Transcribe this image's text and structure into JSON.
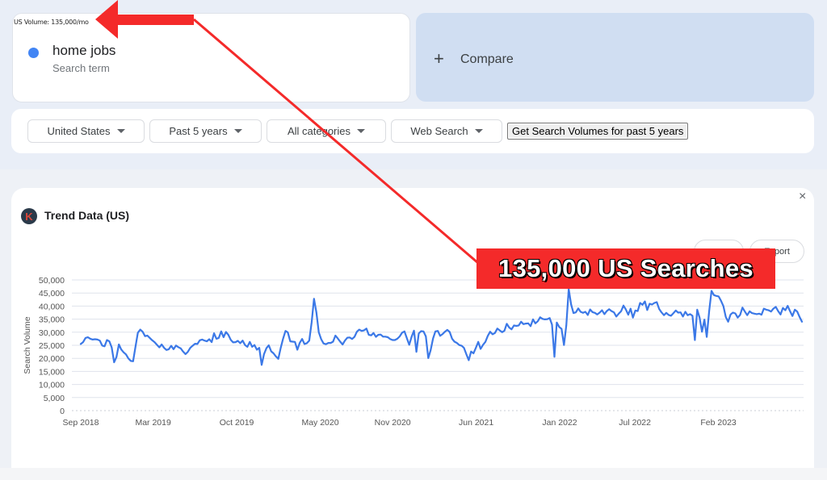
{
  "term_card": {
    "us_volume": "US Volume: 135,000/mo",
    "term": "home jobs",
    "subtitle": "Search term",
    "dot_color": "#4285f4"
  },
  "compare": {
    "icon": "plus-icon",
    "label": "Compare"
  },
  "filters": {
    "country": "United States",
    "period": "Past 5 years",
    "category": "All categories",
    "search_type": "Web Search",
    "get_button": "Get Search Volumes for past 5 years"
  },
  "chart_card": {
    "logo_letter": "K",
    "title": "Trend Data (US)",
    "close_icon": "×",
    "pill_left": "",
    "pill_right": "Export"
  },
  "annotation": {
    "banner": "135,000 US Searches",
    "color": "#f42a2a"
  },
  "chart_data": {
    "type": "line",
    "title": "Trend Data (US)",
    "xlabel": "",
    "ylabel": "Search Volume",
    "ylim": [
      0,
      50000
    ],
    "yticks": [
      0,
      5000,
      10000,
      15000,
      20000,
      25000,
      30000,
      35000,
      40000,
      45000,
      50000
    ],
    "ytick_labels": [
      "0",
      "5,000",
      "10,000",
      "15,000",
      "20,000",
      "25,000",
      "30,000",
      "35,000",
      "40,000",
      "45,000",
      "50,000"
    ],
    "xtick_labels": [
      "Sep 2018",
      "Mar 2019",
      "Oct 2019",
      "May 2020",
      "Nov 2020",
      "Jun 2021",
      "Jan 2022",
      "Jul 2022",
      "Feb 2023"
    ],
    "xtick_positions": [
      0,
      26,
      56,
      86,
      112,
      142,
      172,
      199,
      229
    ],
    "x_count": 260,
    "grid": true,
    "line_color": "#3b78e7",
    "series": [
      {
        "name": "home jobs",
        "values": [
          25500,
          26200,
          27800,
          28100,
          27500,
          27200,
          27300,
          27200,
          26800,
          24900,
          24600,
          27000,
          26500,
          24200,
          18500,
          20500,
          25300,
          23400,
          22300,
          21500,
          20000,
          19000,
          18900,
          24500,
          29800,
          31000,
          30200,
          28500,
          28700,
          27800,
          26900,
          26200,
          25200,
          24200,
          25300,
          24000,
          23200,
          23500,
          24800,
          23500,
          24900,
          24300,
          23800,
          22600,
          21600,
          22500,
          24000,
          24800,
          25600,
          25500,
          26900,
          27200,
          26800,
          26500,
          27300,
          26200,
          29600,
          27500,
          27800,
          30300,
          28100,
          30100,
          29000,
          27100,
          26100,
          26200,
          26700,
          25800,
          26800,
          25100,
          24400,
          26300,
          24400,
          25100,
          23300,
          24000,
          17500,
          21600,
          23900,
          25000,
          22700,
          21900,
          20700,
          19800,
          24000,
          27500,
          30500,
          29900,
          26500,
          26400,
          26300,
          23300,
          25900,
          27400,
          25500,
          25800,
          26800,
          33800,
          42800,
          37500,
          30000,
          27300,
          25700,
          25400,
          25900,
          25900,
          26400,
          28700,
          27600,
          26400,
          25300,
          26800,
          27900,
          28000,
          27400,
          28200,
          30200,
          31000,
          30500,
          30700,
          31400,
          29000,
          28800,
          29700,
          28200,
          29000,
          29100,
          28300,
          28300,
          28100,
          27400,
          27000,
          27000,
          27500,
          28400,
          29800,
          30300,
          27700,
          25200,
          28300,
          30600,
          22500,
          29500,
          30400,
          30300,
          28400,
          20100,
          23100,
          27600,
          30300,
          30500,
          28600,
          29300,
          30200,
          30900,
          30100,
          27500,
          26400,
          25900,
          25100,
          24800,
          24000,
          21600,
          19300,
          22600,
          21900,
          24000,
          26300,
          23600,
          25200,
          26300,
          28600,
          30200,
          29200,
          29700,
          31400,
          30700,
          30000,
          30600,
          33200,
          31800,
          31100,
          32600,
          32400,
          32600,
          34000,
          33100,
          33300,
          33400,
          32300,
          34900,
          33400,
          34200,
          35700,
          35100,
          34900,
          35000,
          35400,
          32900,
          20600,
          33700,
          32000,
          31300,
          25100,
          32600,
          46500,
          40700,
          37300,
          37600,
          39100,
          37800,
          37400,
          37800,
          36600,
          38700,
          37700,
          37400,
          36800,
          37500,
          38400,
          36900,
          38100,
          38800,
          38100,
          37600,
          36000,
          37100,
          38000,
          40200,
          38700,
          36700,
          39000,
          35600,
          38300,
          38100,
          41200,
          40500,
          41800,
          38500,
          40900,
          40600,
          41200,
          41500,
          38900,
          37600,
          36500,
          37400,
          36600,
          36300,
          37300,
          38300,
          37500,
          37600,
          36000,
          37800,
          36500,
          36900,
          36300,
          27000,
          38600,
          35500,
          30200,
          34800,
          28200,
          38100,
          45800,
          44200,
          43900,
          43700,
          42000,
          40000,
          35800,
          34000,
          36800,
          37500,
          37200,
          35600,
          36600,
          39400,
          37900,
          36500,
          38000,
          37300,
          37100,
          36900,
          37100,
          36700,
          39000,
          38600,
          38400,
          37900,
          39000,
          39700,
          38100,
          36800,
          39300,
          38400,
          40100,
          38000,
          36200,
          38600,
          37900,
          35800,
          34000
        ]
      }
    ]
  }
}
